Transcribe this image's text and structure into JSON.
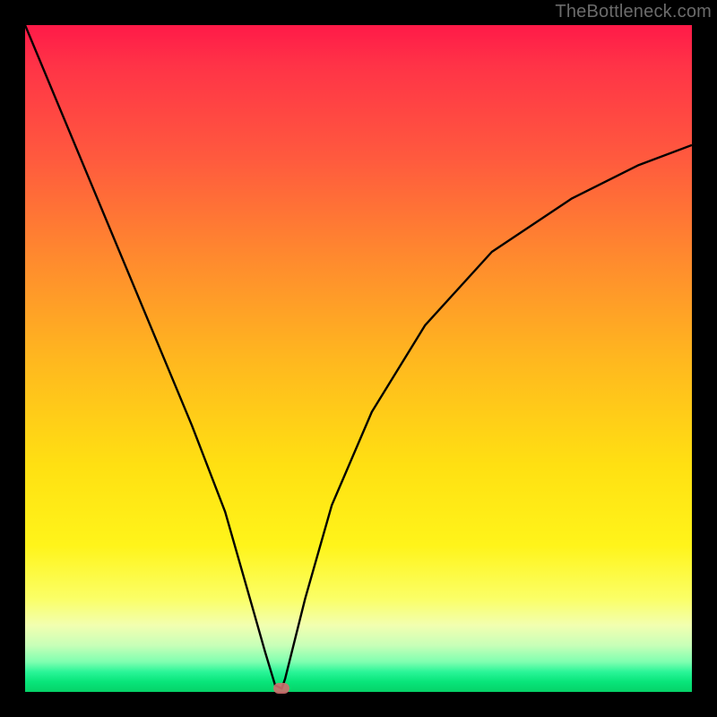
{
  "watermark": {
    "text": "TheBottleneck.com"
  },
  "chart_data": {
    "type": "line",
    "title": "",
    "xlabel": "",
    "ylabel": "",
    "xlim": [
      0,
      100
    ],
    "ylim": [
      0,
      100
    ],
    "grid": false,
    "legend": false,
    "series": [
      {
        "name": "bottleneck-curve",
        "x": [
          0,
          5,
          10,
          15,
          20,
          25,
          30,
          34,
          36,
          37.5,
          38.5,
          39,
          40,
          42,
          46,
          52,
          60,
          70,
          82,
          92,
          100
        ],
        "values": [
          100,
          88,
          76,
          64,
          52,
          40,
          27,
          13,
          6,
          1,
          0.5,
          2,
          6,
          14,
          28,
          42,
          55,
          66,
          74,
          79,
          82
        ]
      }
    ],
    "marker": {
      "x": 38.5,
      "y": 0.5
    },
    "background_gradient": {
      "top": "#ff1a48",
      "mid": "#ffe012",
      "bottom": "#05d268"
    }
  }
}
